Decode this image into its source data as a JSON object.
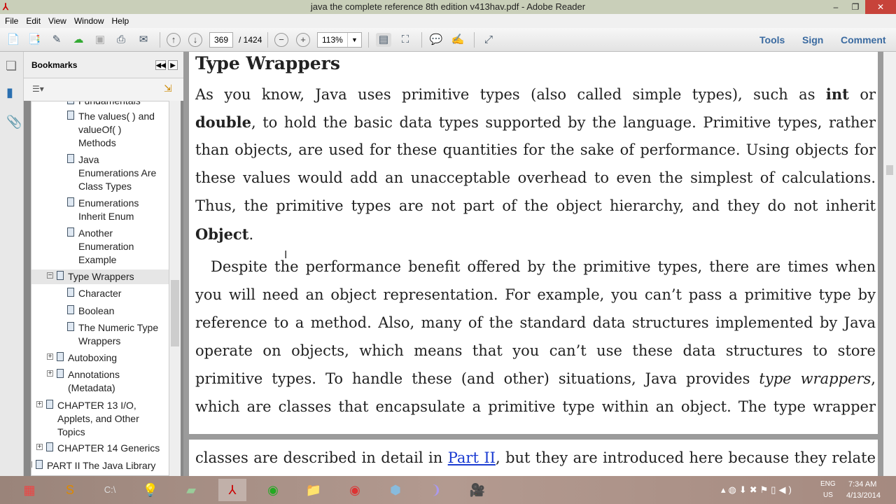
{
  "window": {
    "title": "java the complete reference 8th edition v413hav.pdf - Adobe Reader"
  },
  "menu": [
    "File",
    "Edit",
    "View",
    "Window",
    "Help"
  ],
  "toolbar": {
    "page_current": "369",
    "page_total": "/ 1424",
    "zoom": "113%",
    "tools": "Tools",
    "sign": "Sign",
    "comment": "Comment"
  },
  "bookmarks": {
    "title": "Bookmarks",
    "items": [
      {
        "label": "Fundamentals"
      },
      {
        "label": "The values( ) and valueOf( ) Methods",
        "lines": [
          "The values( ) and",
          "valueOf( )",
          "Methods"
        ]
      },
      {
        "lines": [
          "Java",
          "Enumerations Are",
          "Class Types"
        ]
      },
      {
        "lines": [
          "Enumerations",
          "Inherit Enum"
        ]
      },
      {
        "lines": [
          "Another",
          "Enumeration",
          "Example"
        ]
      },
      {
        "lines": [
          "Type Wrappers"
        ]
      },
      {
        "lines": [
          "Character"
        ]
      },
      {
        "lines": [
          "Boolean"
        ]
      },
      {
        "lines": [
          "The Numeric Type",
          "Wrappers"
        ]
      },
      {
        "lines": [
          "Autoboxing"
        ]
      },
      {
        "lines": [
          "Annotations",
          "(Metadata)"
        ]
      },
      {
        "lines": [
          "CHAPTER 13 I/O,",
          "Applets, and Other",
          "Topics"
        ]
      },
      {
        "lines": [
          "CHAPTER 14 Generics"
        ]
      },
      {
        "lines": [
          "PART II The Java Library"
        ]
      }
    ]
  },
  "document": {
    "heading": "Type Wrappers",
    "p1": [
      [
        "As you know, Java uses primitive types (also called simple types), such as ",
        "int",
        " or"
      ],
      [
        "",
        "double",
        ", to hold the basic data types supported by the language. Primitive types, rather"
      ],
      [
        "than objects, are used for these quantities for the sake of performance. Using objects for"
      ],
      [
        "these values would add an unacceptable overhead to even the simplest of calculations."
      ],
      [
        "Thus, the primitive types are not part of the object hierarchy, and they do not inherit"
      ],
      [
        "",
        "Object",
        "."
      ]
    ],
    "p2": [
      [
        "Despite the performance benefit offered by the primitive types, there are times when"
      ],
      [
        "you will need an object representation. For example, you can’t pass a primitive type by"
      ],
      [
        "reference to a method. Also, many of the standard data structures implemented by Java"
      ],
      [
        "operate on objects, which means that you can’t use these data structures to store"
      ],
      [
        "primitive types. To handle these (and other) situations, Java provides ",
        "type wrappers",
        ","
      ],
      [
        "which are classes that encapsulate a primitive type within an object. The type wrapper"
      ]
    ],
    "p3_pre": "classes are described in detail in ",
    "p3_link": "Part II",
    "p3_post": ", but they are introduced here because they relate"
  },
  "tray": {
    "lang1": "ENG",
    "lang2": "US",
    "time": "7:34 AM",
    "date": "4/13/2014"
  }
}
